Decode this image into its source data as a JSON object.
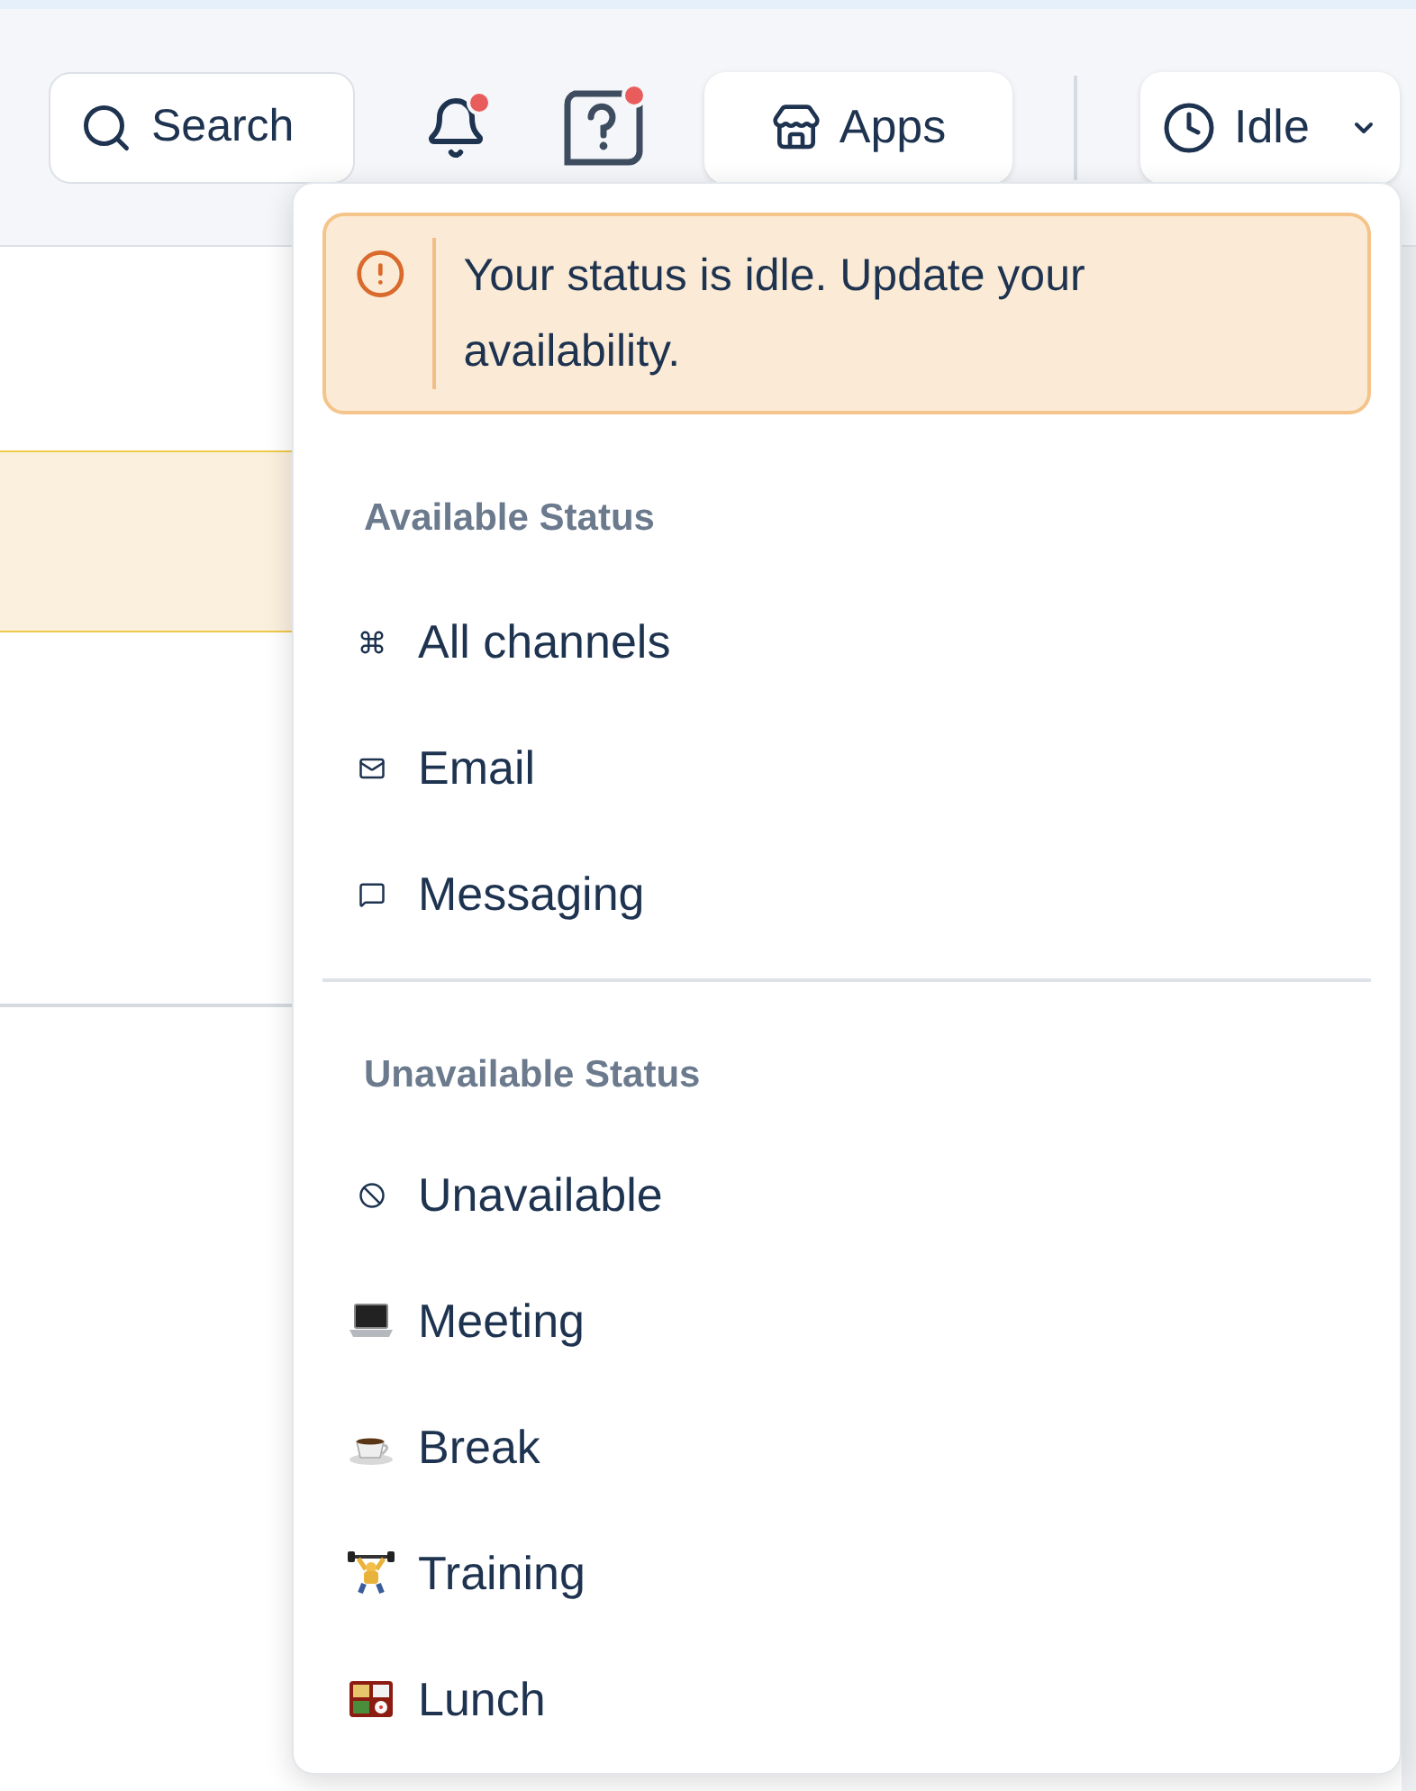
{
  "toolbar": {
    "search": "Search",
    "notifications_badge": true,
    "help_badge": true,
    "apps": "Apps",
    "status": "Idle"
  },
  "status_menu": {
    "alert": "Your status is idle. Update your availability.",
    "sections": [
      {
        "title": "Available Status",
        "items": [
          {
            "kind": "channels",
            "label": "All channels"
          },
          {
            "kind": "email",
            "label": "Email"
          },
          {
            "kind": "messaging",
            "label": "Messaging"
          }
        ]
      },
      {
        "title": "Unavailable Status",
        "items": [
          {
            "kind": "unavailable",
            "label": "Unavailable"
          },
          {
            "kind": "laptop",
            "label": "Meeting"
          },
          {
            "kind": "coffee",
            "label": "Break"
          },
          {
            "kind": "weightlifter",
            "label": "Training"
          },
          {
            "kind": "bento",
            "label": "Lunch"
          }
        ]
      }
    ]
  }
}
